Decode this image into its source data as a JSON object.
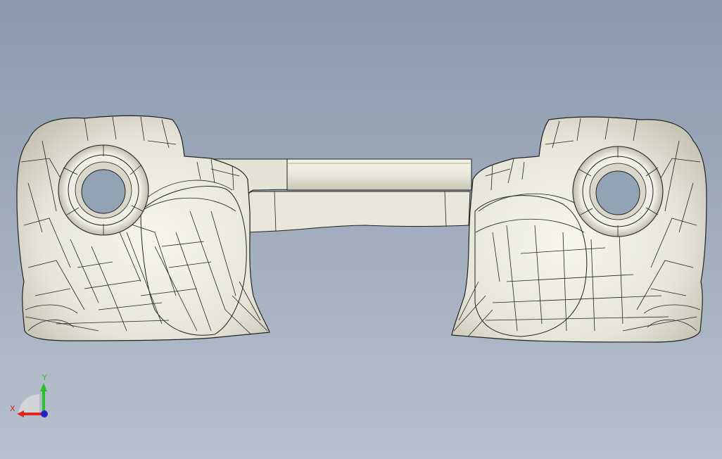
{
  "viewport": {
    "background_top": "#8c9bb0",
    "background_bottom": "#b6bfcb",
    "model_fill": "#ecebe0",
    "model_shadow": "#b9b8a8",
    "edge_color": "#1e1e1e"
  },
  "triad": {
    "x_label": "X",
    "y_label": "Y",
    "x_color": "#e0251a",
    "y_color": "#2bbf2b",
    "z_color": "#2222cc"
  }
}
